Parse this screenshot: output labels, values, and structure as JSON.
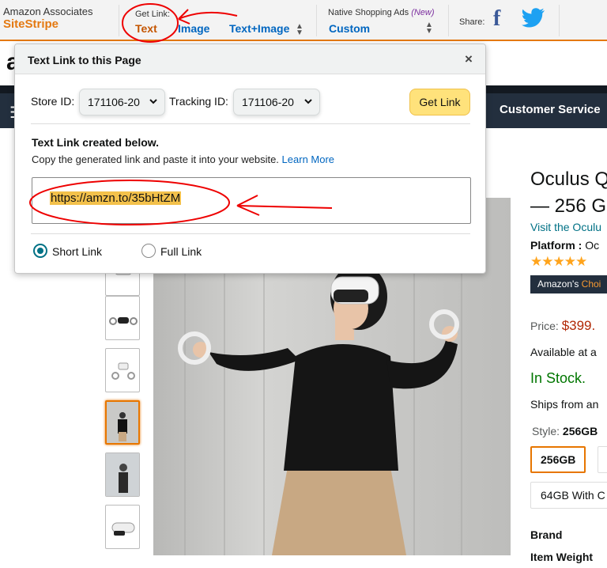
{
  "sitestripe": {
    "brand_line1": "Amazon Associates",
    "brand_line2": "SiteStripe",
    "get_link_label": "Get Link:",
    "text_tab": "Text",
    "image_tab": "Image",
    "text_image_tab": "Text+Image",
    "native_label": "Native Shopping Ads",
    "native_new": "(New)",
    "custom": "Custom",
    "share_label": "Share:",
    "share_icons": [
      "facebook-icon",
      "twitter-icon"
    ],
    "accent_color": "#e47911"
  },
  "header": {
    "logo_letter": "a",
    "customer_service": "Customer Service"
  },
  "popup": {
    "title": "Text Link to this Page",
    "close": "×",
    "store_id_label": "Store ID:",
    "store_id_value": "171106-20",
    "tracking_id_label": "Tracking ID:",
    "tracking_id_value": "171106-20",
    "get_link_button": "Get Link",
    "created_heading": "Text Link created below.",
    "copy_text": "Copy the generated link and paste it into your website.",
    "learn_more": "Learn More",
    "link_value": "https://amzn.to/35bHtZM",
    "short_link": "Short Link",
    "full_link": "Full Link",
    "selected_option": "Short Link"
  },
  "product": {
    "title_line1": "Oculus Q",
    "title_line2": "— 256 G",
    "visit": "Visit the Oculu",
    "platform_label": "Platform :",
    "platform_value": "Oc",
    "stars": "★★★★★",
    "choice_prefix": "Amazon's",
    "choice_suffix": "Choi",
    "price_label": "Price:",
    "price_value": "$399.",
    "available": "Available at a",
    "in_stock": "In Stock.",
    "ships": "Ships from an",
    "style_label": "Style:",
    "style_value": "256GB",
    "options": [
      "256GB",
      "64GB With C"
    ],
    "specs": [
      "Brand",
      "Item Weight"
    ]
  }
}
